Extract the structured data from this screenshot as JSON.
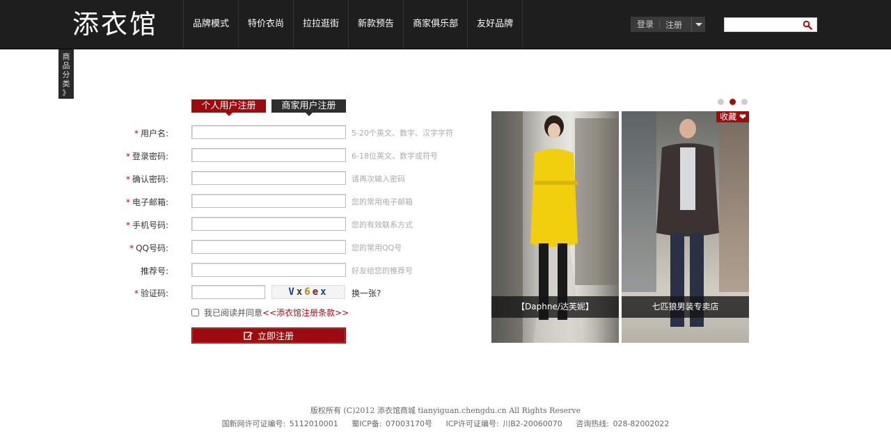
{
  "header": {
    "logo": "添衣馆",
    "nav": [
      "品牌模式",
      "特价衣尚",
      "拉拉逛街",
      "新款预告",
      "商家俱乐部",
      "友好品牌"
    ],
    "login": "登录",
    "register": "注册",
    "search_placeholder": ""
  },
  "side_tab": [
    "商",
    "品",
    "分",
    "类",
    "》"
  ],
  "tabs": {
    "personal": "个人用户注册",
    "merchant": "商家用户注册"
  },
  "form": {
    "username": {
      "label": "用户名:",
      "hint": "5-20个英文、数字、汉字字符"
    },
    "password": {
      "label": "登录密码:",
      "hint": "6-18位英文、数字或符号"
    },
    "confirm": {
      "label": "确认密码:",
      "hint": "请再次输入密码"
    },
    "email": {
      "label": "电子邮箱:",
      "hint": "您的常用电子邮箱"
    },
    "mobile": {
      "label": "手机号码:",
      "hint": "您的有效联系方式"
    },
    "qq": {
      "label": "QQ号码:",
      "hint": "您的常用QQ号"
    },
    "referrer": {
      "label": "推荐号:",
      "hint": "好友给您的推荐号"
    },
    "captcha": {
      "label": "验证码:",
      "code1": "V",
      "code2": "x",
      "code3": "6",
      "code4": "e",
      "code5": "x",
      "refresh": "换一张?"
    },
    "required_mark": "*",
    "agree_text": "我已阅读并同意",
    "agree_link": "<<添衣馆注册条款>>",
    "submit": "立即注册"
  },
  "promos": {
    "left": {
      "caption": "【Daphne/达芙妮】"
    },
    "right": {
      "caption": "七匹狼男装专卖店",
      "fav": "收藏"
    }
  },
  "footer": {
    "line1": "版权所有 (C)2012 添衣馆商城 tianyiguan.chengdu.cn All Rights Reserve",
    "item1": "国新网许可证编号: 5112010001",
    "item2": "蜀ICP备: 07003170号",
    "item3": "ICP许可证编号: 川B2-20060070",
    "item4": "咨询热线: 028-82002022"
  },
  "colors": {
    "accent": "#9e0b0f",
    "header_bg": "#1e1e1e"
  }
}
